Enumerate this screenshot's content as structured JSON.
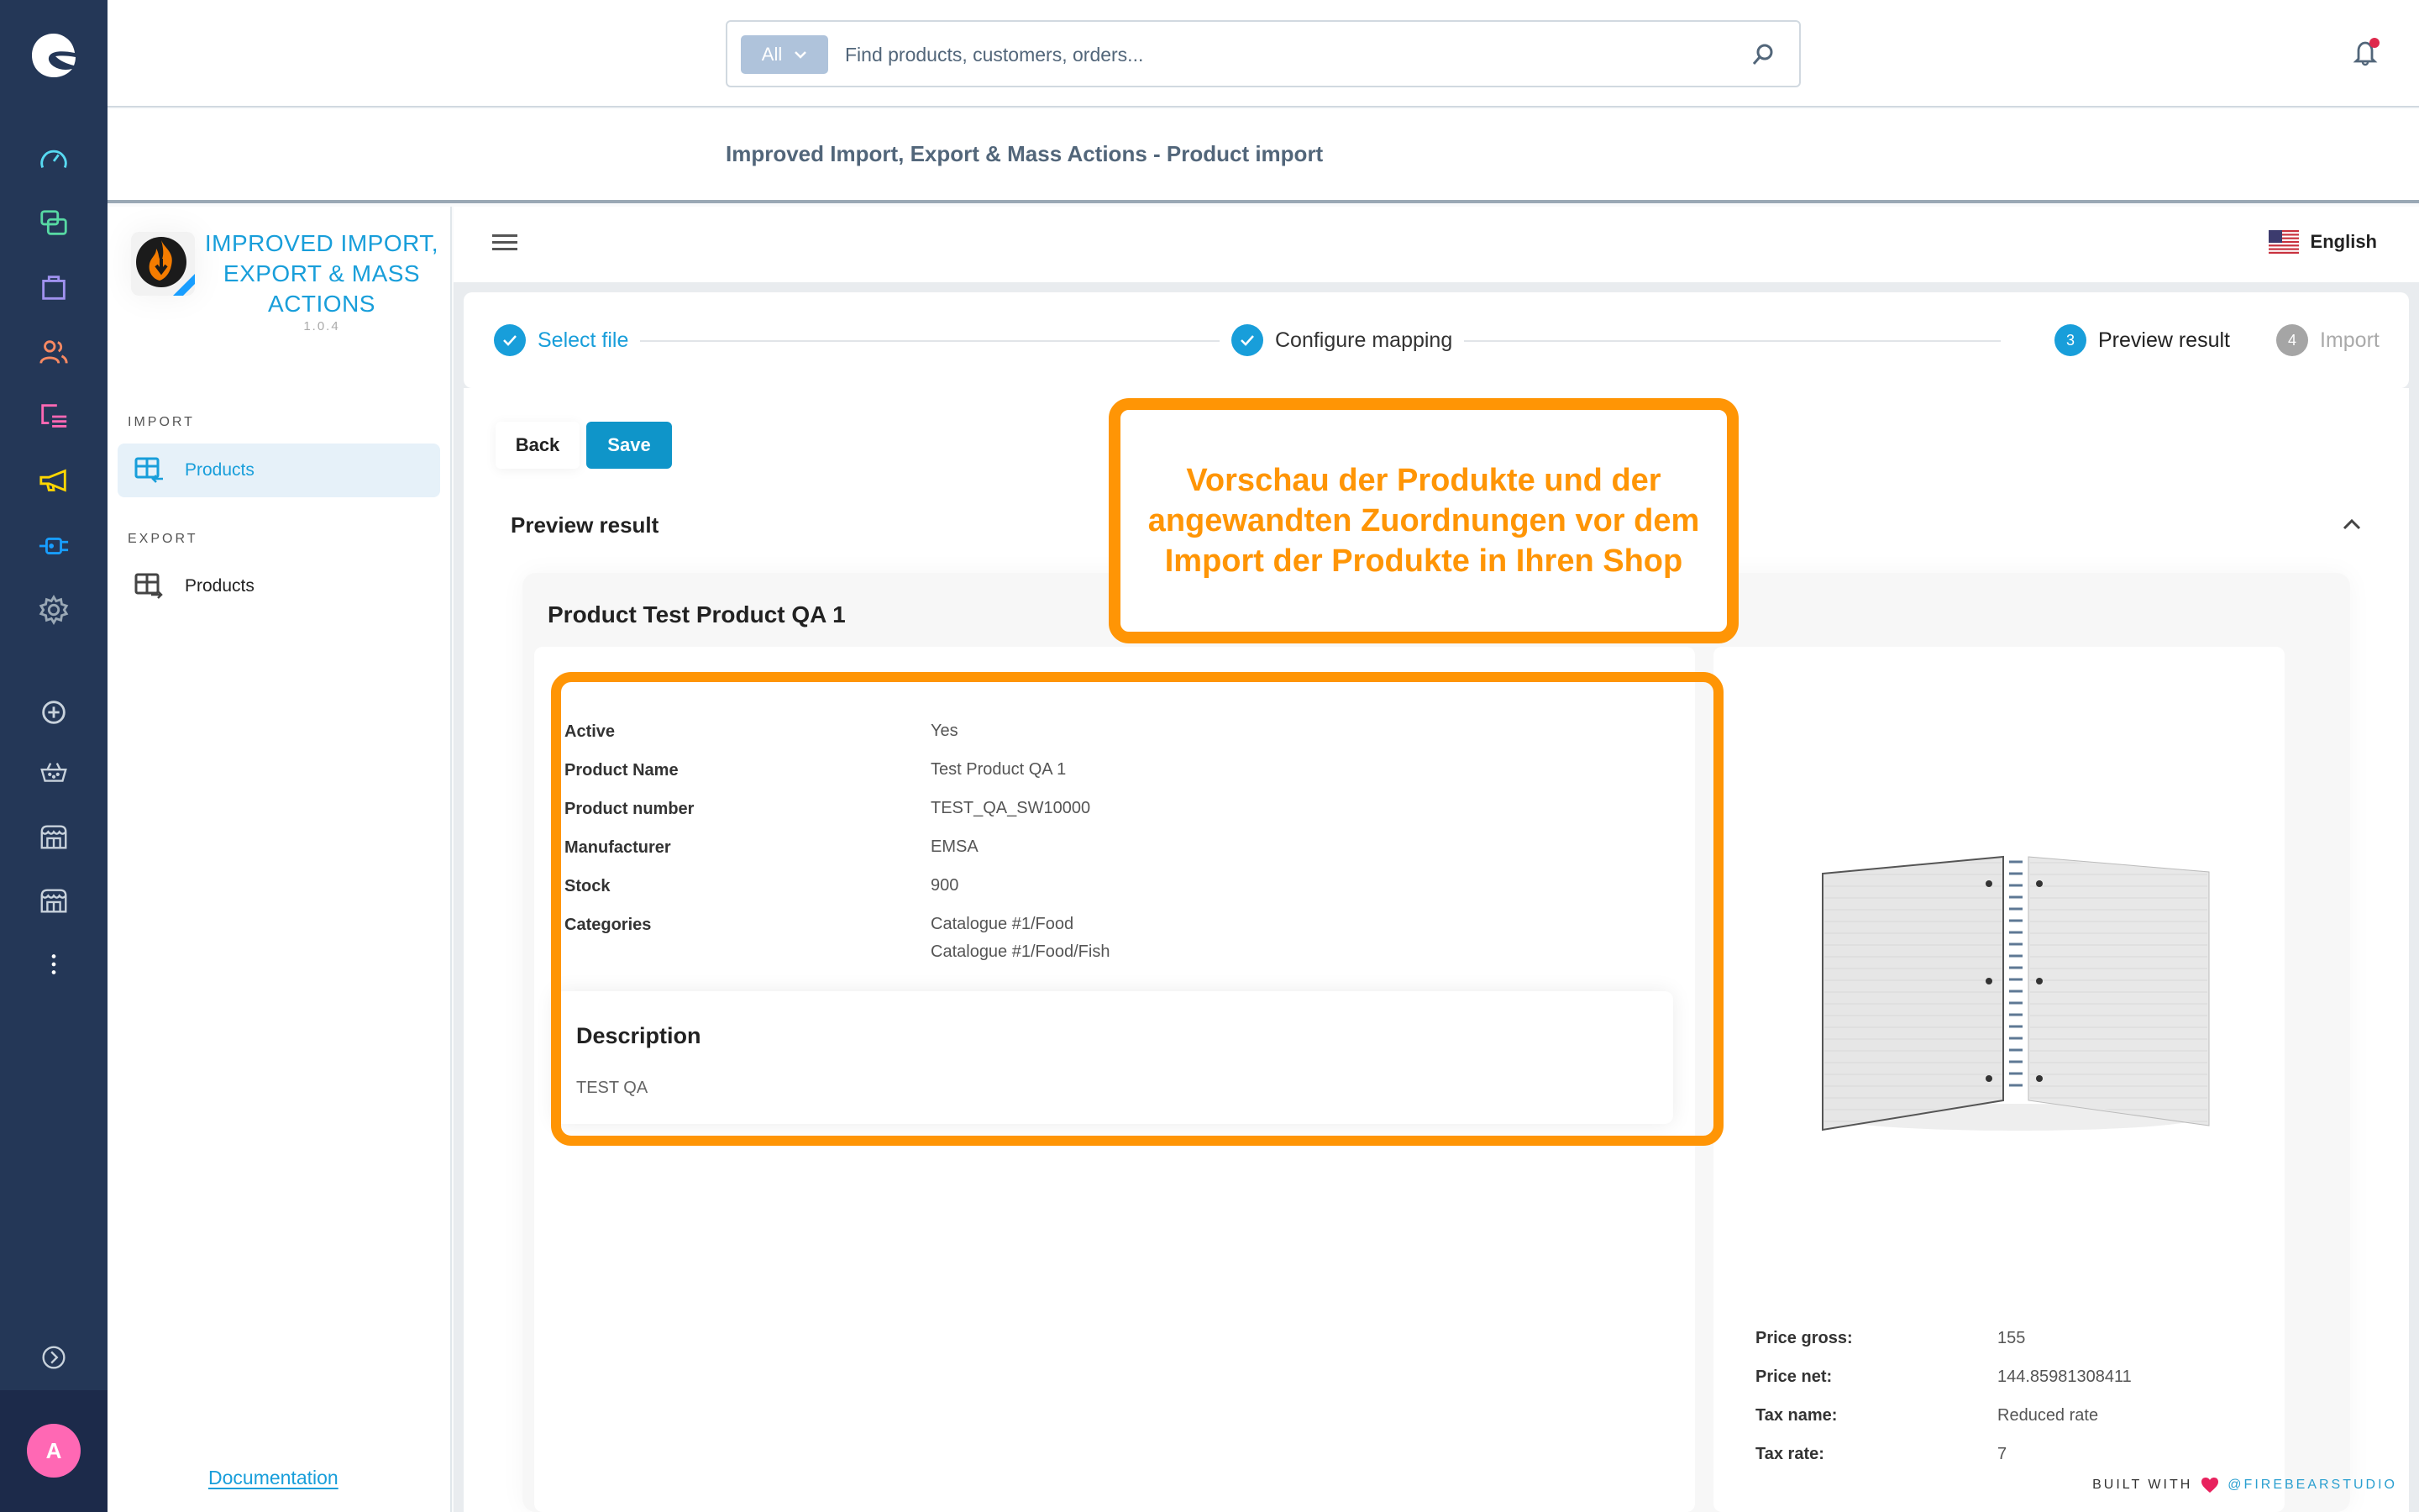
{
  "rail": {
    "logo": "shopware-logo-icon",
    "items": [
      {
        "name": "dashboard-icon",
        "color": "#57d9f1"
      },
      {
        "name": "catalogue-icon",
        "color": "#57d9a3"
      },
      {
        "name": "orders-icon",
        "color": "#a092f0"
      },
      {
        "name": "customers-icon",
        "color": "#f88962"
      },
      {
        "name": "content-icon",
        "color": "#ff68b4"
      },
      {
        "name": "marketing-icon",
        "color": "#ffd700"
      },
      {
        "name": "extensions-icon",
        "color": "#189eff"
      },
      {
        "name": "settings-icon",
        "color": "#9aa8b5"
      }
    ],
    "sales_channels": [
      {
        "name": "add-sales-channel-icon"
      },
      {
        "name": "headless-channel-icon"
      },
      {
        "name": "storefront-channel-icon"
      },
      {
        "name": "storefront-channel-icon"
      },
      {
        "name": "more-icon"
      }
    ],
    "expand_icon": "expand-chevron-icon",
    "avatar_initial": "A",
    "avatar_color": "#ff68b4"
  },
  "header": {
    "search_type": "All",
    "search_placeholder": "Find products, customers, orders...",
    "notification_badge": true
  },
  "page": {
    "title": "Improved Import, Export & Mass Actions - Product import"
  },
  "plugin": {
    "name": "IMPROVED IMPORT, EXPORT & MASS ACTIONS",
    "version": "1.0.4",
    "sections": [
      {
        "label": "IMPORT",
        "items": [
          {
            "label": "Products",
            "active": true
          }
        ]
      },
      {
        "label": "EXPORT",
        "items": [
          {
            "label": "Products",
            "active": false
          }
        ]
      }
    ],
    "documentation_label": "Documentation"
  },
  "toolbar": {
    "language": "English"
  },
  "stepper": {
    "steps": [
      {
        "number": "1",
        "label": "Select file",
        "state": "done"
      },
      {
        "number": "2",
        "label": "Configure mapping",
        "state": "done"
      },
      {
        "number": "3",
        "label": "Preview result",
        "state": "current"
      },
      {
        "number": "4",
        "label": "Import",
        "state": "pending"
      }
    ]
  },
  "actions": {
    "back_label": "Back",
    "save_label": "Save"
  },
  "preview": {
    "title": "Preview result",
    "product_title": "Product Test Product QA 1",
    "attributes": [
      {
        "label": "Active",
        "value": [
          "Yes"
        ]
      },
      {
        "label": "Product Name",
        "value": [
          "Test Product QA 1"
        ]
      },
      {
        "label": "Product number",
        "value": [
          "TEST_QA_SW10000"
        ]
      },
      {
        "label": "Manufacturer",
        "value": [
          "EMSA"
        ]
      },
      {
        "label": "Stock",
        "value": [
          "900"
        ]
      },
      {
        "label": "Categories",
        "value": [
          "Catalogue #1/Food",
          "Catalogue #1/Food/Fish"
        ]
      }
    ],
    "description_title": "Description",
    "description_text": "TEST QA",
    "image_alt": "spiral notebook",
    "prices": [
      {
        "label": "Price gross:",
        "value": "155"
      },
      {
        "label": "Price net:",
        "value": "144.85981308411"
      },
      {
        "label": "Tax name:",
        "value": "Reduced rate"
      },
      {
        "label": "Tax rate:",
        "value": "7"
      }
    ]
  },
  "callout": {
    "text": "Vorschau der Produkte und der angewandten Zuordnungen vor dem Import der Produkte in Ihren Shop",
    "color": "#ff9505"
  },
  "footer": {
    "built_with": "BUILT WITH",
    "brand": "@FIREBEARSTUDIO"
  },
  "colors": {
    "accent": "#189eda",
    "primary_button": "#0f95c9",
    "highlight": "#ff9505",
    "rail_bg": "#243757"
  }
}
